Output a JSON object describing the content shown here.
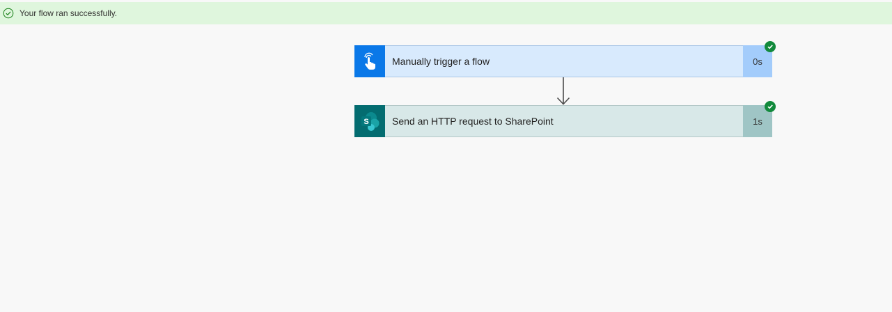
{
  "banner": {
    "message": "Your flow ran successfully.",
    "icon": "check-circle-icon",
    "background_color": "#dff6dd"
  },
  "steps": [
    {
      "title": "Manually trigger a flow",
      "duration": "0s",
      "icon": "hand-pointer-icon",
      "status": "succeeded",
      "accent_color": "#0a78e8"
    },
    {
      "title": "Send an HTTP request to SharePoint",
      "duration": "1s",
      "icon": "sharepoint-icon",
      "icon_letter": "S",
      "status": "succeeded",
      "accent_color": "#036c70"
    }
  ],
  "connector": {
    "icon": "arrow-down-icon"
  }
}
